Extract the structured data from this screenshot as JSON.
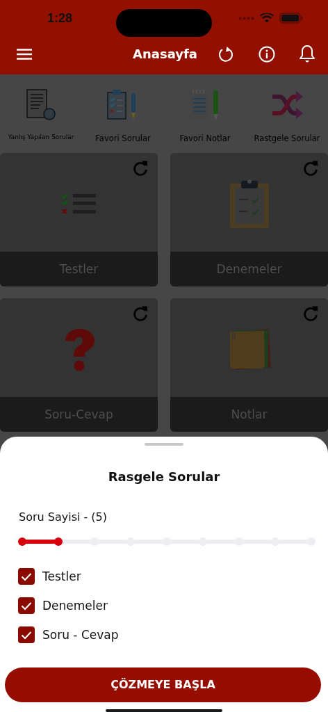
{
  "status_bar": {
    "time": "1:28"
  },
  "header": {
    "title": "Anasayfa"
  },
  "shortcuts": [
    {
      "kind": "wrong",
      "label": "Yanlış Yapılan Sorular"
    },
    {
      "kind": "favorite",
      "label": "Favori Sorular"
    },
    {
      "kind": "notes",
      "label": "Favori Notlar"
    },
    {
      "kind": "shuffle",
      "label": "Rastgele Sorular"
    }
  ],
  "cards": [
    {
      "kind": "list",
      "label": "Testler"
    },
    {
      "kind": "clipboard",
      "label": "Denemeler"
    },
    {
      "kind": "question",
      "label": "Soru-Cevap"
    },
    {
      "kind": "sticky",
      "label": "Notlar"
    }
  ],
  "sheet": {
    "title": "Rasgele Sorular",
    "count_label": "Soru Sayisi - (5)",
    "slider": {
      "level": 0.125
    },
    "options": [
      {
        "label": "Testler",
        "checked": true
      },
      {
        "label": "Denemeler",
        "checked": true
      },
      {
        "label": "Soru - Cevap",
        "checked": true
      }
    ],
    "button": "ÇÖZMEYE BAŞLA"
  }
}
